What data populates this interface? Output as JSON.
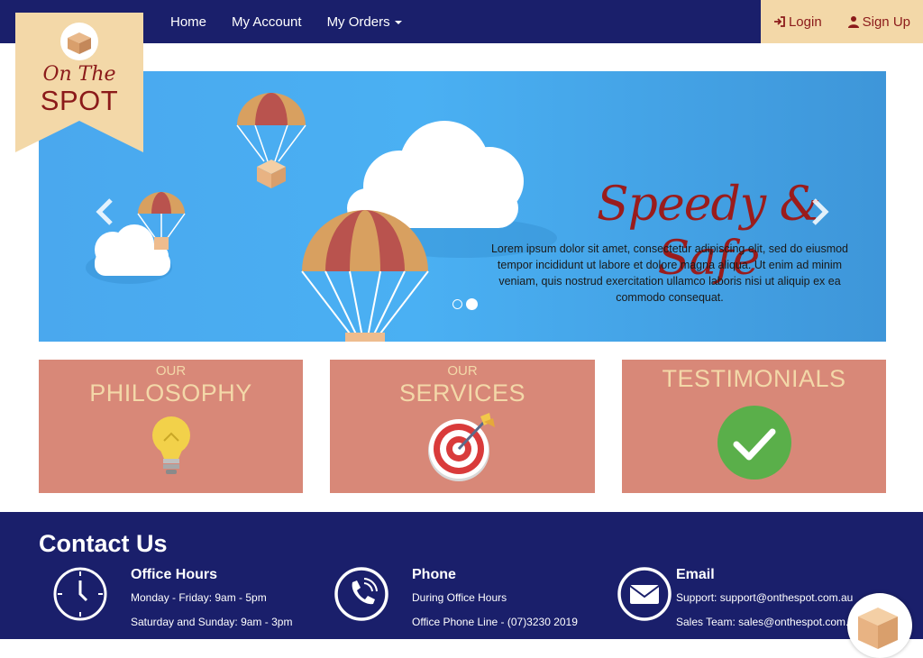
{
  "nav": {
    "home": "Home",
    "my_account": "My Account",
    "my_orders": "My Orders",
    "login": "Login",
    "signup": "Sign Up"
  },
  "logo": {
    "line1": "On The",
    "line2": "SPOT"
  },
  "carousel": {
    "title": "Speedy & Safe",
    "text": "Lorem ipsum dolor sit amet, consectetur adipiscing elit, sed do eiusmod tempor incididunt ut labore et dolore magna aliqua. Ut enim ad minim veniam, quis nostrud exercitation ullamco laboris nisi ut aliquip ex ea commodo consequat.",
    "slide_count": 2,
    "active_slide": 2
  },
  "features": [
    {
      "small": "OUR",
      "big": "PHILOSOPHY",
      "icon": "lightbulb-icon"
    },
    {
      "small": "OUR",
      "big": "SERVICES",
      "icon": "target-icon"
    },
    {
      "small": "",
      "big": "TESTIMONIALS",
      "icon": "checkmark-icon"
    }
  ],
  "contact": {
    "title": "Contact Us",
    "columns": [
      {
        "title": "Office Hours",
        "line1": "Monday - Friday: 9am - 5pm",
        "line2": "Saturday and Sunday: 9am - 3pm",
        "icon": "clock-icon"
      },
      {
        "title": "Phone",
        "line1": "During Office Hours",
        "line2": "Office Phone Line - (07)3230 2019",
        "icon": "phone-icon"
      },
      {
        "title": "Email",
        "line1": "Support: support@onthespot.com.au",
        "line2": "Sales Team: sales@onthespot.com.au",
        "icon": "envelope-icon"
      }
    ]
  },
  "colors": {
    "navy": "#1a1f6b",
    "cream": "#f3d8a8",
    "brand_red": "#8b1a1a",
    "salmon": "#d88878",
    "sky": "#4aa8ee"
  }
}
